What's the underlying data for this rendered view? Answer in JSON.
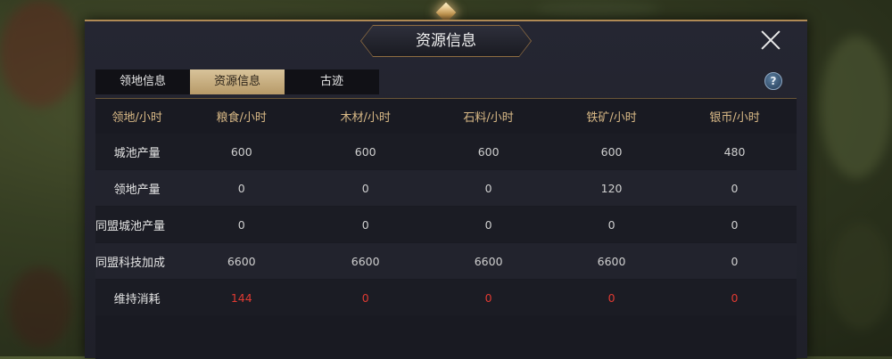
{
  "dialog": {
    "title": "资源信息",
    "tabs": [
      {
        "label": "领地信息",
        "active": false
      },
      {
        "label": "资源信息",
        "active": true
      },
      {
        "label": "古迹",
        "active": false
      }
    ],
    "help_glyph": "?",
    "close_icon": "close-icon",
    "help_icon": "help-icon"
  },
  "table": {
    "headers": [
      "领地/小时",
      "粮食/小时",
      "木材/小时",
      "石料/小时",
      "铁矿/小时",
      "银币/小时"
    ],
    "rows": [
      {
        "label": "城池产量",
        "values": [
          "600",
          "600",
          "600",
          "600",
          "480"
        ]
      },
      {
        "label": "领地产量",
        "values": [
          "0",
          "0",
          "0",
          "120",
          "0"
        ]
      },
      {
        "label": "同盟城池产量",
        "values": [
          "0",
          "0",
          "0",
          "0",
          "0"
        ]
      },
      {
        "label": "同盟科技加成",
        "values": [
          "6600",
          "6600",
          "6600",
          "6600",
          "0"
        ]
      },
      {
        "label": "维持消耗",
        "values": [
          "144",
          "0",
          "0",
          "0",
          "0"
        ]
      }
    ]
  },
  "colors": {
    "accent_gold": "#d9b986",
    "negative_red": "#e03a32",
    "tab_active": "#c9b07f"
  }
}
